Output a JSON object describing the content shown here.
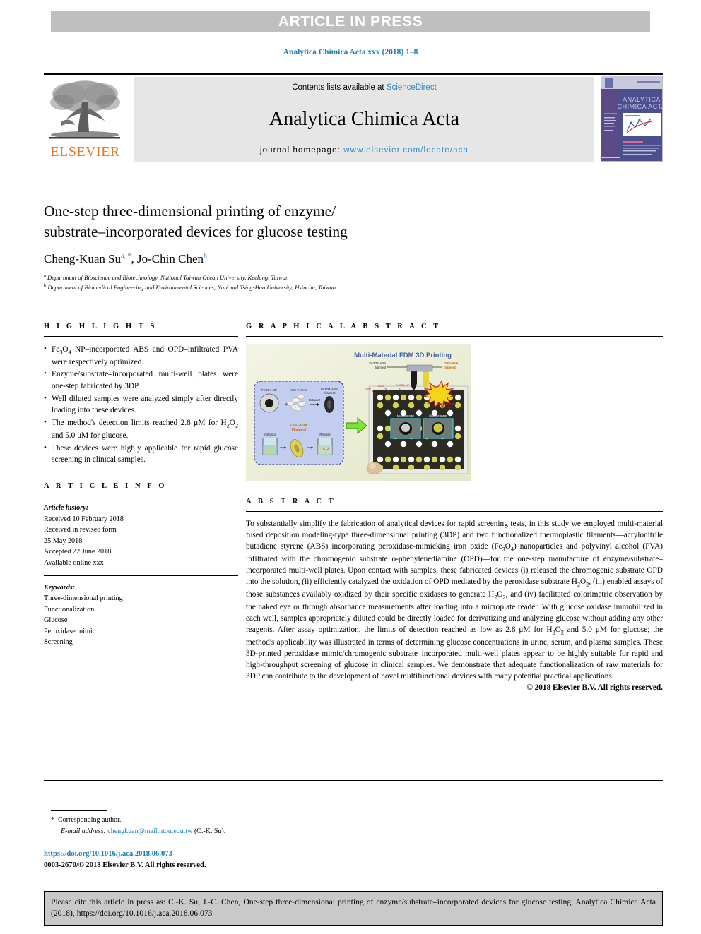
{
  "banner": {
    "text": "ARTICLE IN PRESS"
  },
  "journal_line": "Analytica Chimica Acta xxx (2018) 1–8",
  "masthead": {
    "publisher": "ELSEVIER",
    "contents_prefix": "Contents lists available at ",
    "contents_link": "ScienceDirect",
    "journal_title": "Analytica Chimica Acta",
    "homepage_prefix": "journal homepage: ",
    "homepage_url": "www.elsevier.com/locate/aca",
    "cover_title": "ANALYTICA CHIMICA ACTA"
  },
  "article": {
    "title": "One-step three-dimensional printing of enzyme/substrate–incorporated devices for glucose testing",
    "title_line1": "One-step three-dimensional printing of enzyme/",
    "title_line2": "substrate–incorporated devices for glucose testing",
    "author1": "Cheng-Kuan Su",
    "author1_marks": "a, *",
    "author2": "Jo-Chin Chen",
    "author2_marks": "b",
    "affiliations": [
      {
        "mark": "a",
        "text": "Department of Bioscience and Biotechnology, National Taiwan Ocean University, Keelung, Taiwan"
      },
      {
        "mark": "b",
        "text": "Department of Biomedical Engineering and Environmental Sciences, National Tsing-Hua University, Hsinchu, Taiwan"
      }
    ]
  },
  "sections": {
    "highlights_heading": "H I G H L I G H T S",
    "graphical_abstract_heading": "G R A P H I C A L   A B S T R A C T",
    "article_info_heading": "A R T I C L E   I N F O",
    "abstract_heading": "A B S T R A C T"
  },
  "highlights": [
    "Fe3O4 NP–incorporated ABS and OPD–infiltrated PVA were respectively optimized.",
    "Enzyme/substrate–incorporated multi-well plates were one-step fabricated by 3DP.",
    "Well diluted samples were analyzed simply after directly loading into these devices.",
    "The method's detection limits reached 2.8 μM for H2O2 and 5.0 μM for glucose.",
    "These devices were highly applicable for rapid glucose screening in clinical samples."
  ],
  "graphical_abstract": {
    "title": "Multi-Material FDM 3D Printing",
    "labels": {
      "filament_left": "Fe3O4–ABS Filament",
      "filament_right": "OPD–PVA filament",
      "nanoparticle": "Fe3O4 NP",
      "powder": "ABS Pellets",
      "extruder": "Extruder",
      "abs_filament": "Fe3O4–ABS Filament",
      "opd_filament": "OPD–PVA Filament",
      "infiltration": "Infiltration",
      "release": "Release",
      "gox": "GOx",
      "opd": "OPD",
      "well_left": "Multi-purpose",
      "well_right": "Glucose assay",
      "burst": "One-step multi-well plate"
    }
  },
  "article_info": {
    "history_label": "Article history:",
    "history": [
      "Received 10 February 2018",
      "Received in revised form",
      "25 May 2018",
      "Accepted 22 June 2018",
      "Available online xxx"
    ],
    "keywords_label": "Keywords:",
    "keywords": [
      "Three-dimensional printing",
      "Functionalization",
      "Glucose",
      "Peroxidase mimic",
      "Screening"
    ]
  },
  "abstract": {
    "body": "To substantially simplify the fabrication of analytical devices for rapid screening tests, in this study we employed multi-material fused deposition modeling-type three-dimensional printing (3DP) and two functionalized thermoplastic filaments—acrylonitrile butadiene styrene (ABS) incorporating peroxidase-mimicking iron oxide (Fe3O4) nanoparticles and polyvinyl alcohol (PVA) infiltrated with the chromogenic substrate o-phenylenediamine (OPD)—for the one-step manufacture of enzyme/substrate–incorporated multi-well plates. Upon contact with samples, these fabricated devices (i) released the chromogenic substrate OPD into the solution, (ii) efficiently catalyzed the oxidation of OPD mediated by the peroxidase substrate H2O2, (iii) enabled assays of those substances availably oxidized by their specific oxidases to generate H2O2, and (iv) facilitated colorimetric observation by the naked eye or through absorbance measurements after loading into a microplate reader. With glucose oxidase immobilized in each well, samples appropriately diluted could be directly loaded for derivatizing and analyzing glucose without adding any other reagents. After assay optimization, the limits of detection reached as low as 2.8 μM for H2O2 and 5.0 μM for glucose; the method's applicability was illustrated in terms of determining glucose concentrations in urine, serum, and plasma samples. These 3D-printed peroxidase mimic/chromogenic substrate–incorporated multi-well plates appear to be highly suitable for rapid and high-throughput screening of glucose in clinical samples. We demonstrate that adequate functionalization of raw materials for 3DP can contribute to the development of novel multifunctional devices with many potential practical applications.",
    "copyright": "© 2018 Elsevier B.V. All rights reserved."
  },
  "footer": {
    "corresponding_author": "Corresponding author.",
    "email_label": "E-mail address:",
    "email": "chengkuan@mail.ntou.edu.tw",
    "email_suffix": "(C.-K. Su).",
    "doi": "https://doi.org/10.1016/j.aca.2018.06.073",
    "issn": "0003-2670/© 2018 Elsevier B.V. All rights reserved."
  },
  "citation_box": {
    "text": "Please cite this article in press as: C.-K. Su, J.-C. Chen, One-step three-dimensional printing of enzyme/substrate–incorporated devices for glucose testing, Analytica Chimica Acta (2018), https://doi.org/10.1016/j.aca.2018.06.073"
  },
  "colors": {
    "banner_bg": "#bfbfbf",
    "link_blue": "#1a7db6",
    "sciencedirect_blue": "#2e8ecb",
    "elsevier_orange": "#e87722",
    "panel_gray": "#e6e6e6",
    "cite_gray": "#c9c9c9",
    "ga_bg": "#eef0dc"
  }
}
